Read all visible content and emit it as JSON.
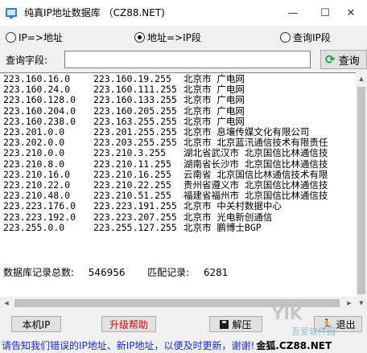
{
  "window": {
    "title": "纯真IP地址数据库 （CZ88.NET)",
    "minimize": "—",
    "maximize": "☐",
    "close": "✕"
  },
  "search_modes": [
    {
      "label": "IP=>地址",
      "checked": false
    },
    {
      "label": "地址=>IP段",
      "checked": true
    },
    {
      "label": "查询IP段",
      "checked": false
    }
  ],
  "query": {
    "label": "查询字段:",
    "value": "",
    "button_label": "查询",
    "button_icon": "refresh-icon"
  },
  "results": {
    "rows": [
      [
        "223.160.16.0",
        "223.160.19.255",
        "北京市 广电网"
      ],
      [
        "223.160.24.0",
        "223.160.111.255",
        "北京市 广电网"
      ],
      [
        "223.160.128.0",
        "223.160.133.255",
        "北京市 广电网"
      ],
      [
        "223.160.204.0",
        "223.160.205.255",
        "北京市 广电网"
      ],
      [
        "223.160.238.0",
        "223.163.255.255",
        "北京市 广电网"
      ],
      [
        "223.201.0.0",
        "223.201.255.255",
        "北京市 息壤传媒文化有限公司"
      ],
      [
        "223.202.0.0",
        "223.203.255.255",
        "北京市 北京蓝汛通信技术有限责任"
      ],
      [
        "223.210.0.0",
        "223.210.3.255",
        "湖北省武汉市 北京国信比林通信技"
      ],
      [
        "223.210.8.0",
        "223.210.11.255",
        "湖南省长沙市 北京国信比林通信技"
      ],
      [
        "223.210.16.0",
        "223.210.16.255",
        "云南省 北京国信比林通信技术有限"
      ],
      [
        "223.210.22.0",
        "223.210.22.255",
        "贵州省遵义市 北京国信比林通信技"
      ],
      [
        "223.210.48.0",
        "223.210.51.255",
        "福建省福州市 北京国信比林通信技"
      ],
      [
        "223.223.176.0",
        "223.223.191.255",
        "北京市 中关村数据中心"
      ],
      [
        "223.223.192.0",
        "223.223.207.255",
        "北京市 光电新创通信"
      ],
      [
        "223.255.0.0",
        "223.255.127.255",
        "北京市 鹏博士BGP"
      ]
    ],
    "summary_label": "数据库记录总数:",
    "summary_total": "546956",
    "match_label": "匹配记录:",
    "match_count": "6281"
  },
  "buttons": {
    "local_ip": "本机IP",
    "upgrade_help": "升级帮助",
    "decompress": "解压",
    "exit": "退出"
  },
  "colors": {
    "upgrade_text": "#e00000",
    "status_text": "#1a2bd6",
    "accent_green": "#1a9a2a"
  },
  "status": {
    "note": "请告知我们错误的IP地址、新IP地址，以便及时更新，谢谢!",
    "site": "金狐.CZ88.NET"
  },
  "watermark": {
    "main": "YIK",
    "sub": "吾爱软件园"
  }
}
